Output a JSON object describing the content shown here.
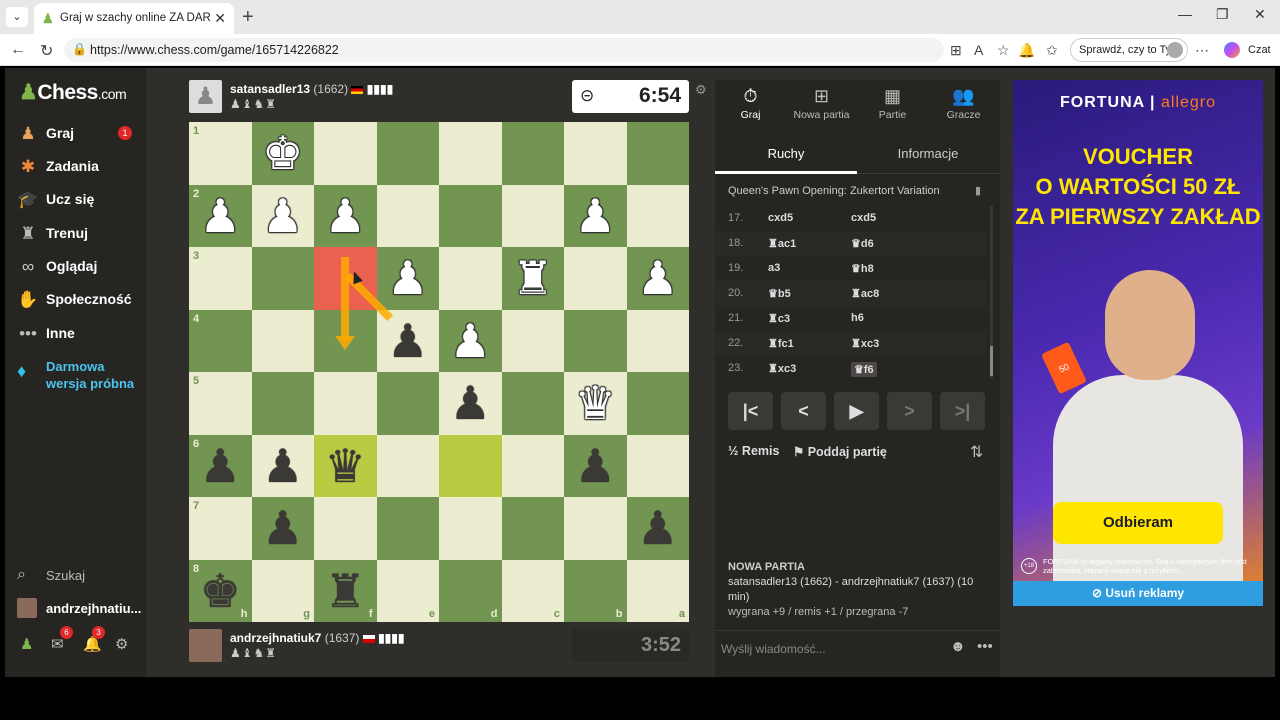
{
  "browser": {
    "tab_title": "Graj w szachy online ZA DARMO",
    "url": "https://www.chess.com/game/165714226822",
    "profile_label": "Sprawdź, czy to Ty",
    "chat_label": "Czat"
  },
  "sidebar": {
    "logo_main": "Chess",
    "logo_suffix": ".com",
    "items": [
      {
        "label": "Graj",
        "icon": "pawn-icon",
        "badge": "1"
      },
      {
        "label": "Zadania",
        "icon": "puzzle-icon"
      },
      {
        "label": "Ucz się",
        "icon": "graduation-cap-icon"
      },
      {
        "label": "Trenuj",
        "icon": "rook-icon"
      },
      {
        "label": "Oglądaj",
        "icon": "binoculars-icon"
      },
      {
        "label": "Społeczność",
        "icon": "community-icon"
      },
      {
        "label": "Inne",
        "icon": "more-dots-icon"
      }
    ],
    "promo": "Darmowa wersja próbna",
    "search": "Szukaj",
    "username": "andrzejhnatiu...",
    "messages_badge": "6",
    "notifications_badge": "3"
  },
  "top_player": {
    "name": "satansadler13",
    "rating": "(1662)",
    "captured": "♟♝♞♜",
    "clock": "6:54"
  },
  "bottom_player": {
    "name": "andrzejhnatiuk7",
    "rating": "(1637)",
    "captured": "♟♝♞♜",
    "clock": "3:52"
  },
  "board": {
    "rank_labels": [
      "1",
      "2",
      "3",
      "4",
      "5",
      "6",
      "7",
      "8"
    ],
    "file_labels": [
      "h",
      "g",
      "f",
      "e",
      "d",
      "c",
      "b",
      "a"
    ],
    "pieces": [
      {
        "r": 0,
        "c": 1,
        "p": "♚",
        "col": "w"
      },
      {
        "r": 1,
        "c": 0,
        "p": "♟",
        "col": "w"
      },
      {
        "r": 1,
        "c": 1,
        "p": "♟",
        "col": "w"
      },
      {
        "r": 1,
        "c": 2,
        "p": "♟",
        "col": "w"
      },
      {
        "r": 1,
        "c": 6,
        "p": "♟",
        "col": "w"
      },
      {
        "r": 2,
        "c": 3,
        "p": "♟",
        "col": "w"
      },
      {
        "r": 2,
        "c": 5,
        "p": "♜",
        "col": "w"
      },
      {
        "r": 2,
        "c": 7,
        "p": "♟",
        "col": "w"
      },
      {
        "r": 3,
        "c": 3,
        "p": "♟",
        "col": "b"
      },
      {
        "r": 3,
        "c": 4,
        "p": "♟",
        "col": "w"
      },
      {
        "r": 4,
        "c": 4,
        "p": "♟",
        "col": "b"
      },
      {
        "r": 4,
        "c": 6,
        "p": "♛",
        "col": "w"
      },
      {
        "r": 5,
        "c": 0,
        "p": "♟",
        "col": "b"
      },
      {
        "r": 5,
        "c": 1,
        "p": "♟",
        "col": "b"
      },
      {
        "r": 5,
        "c": 2,
        "p": "♛",
        "col": "b"
      },
      {
        "r": 5,
        "c": 6,
        "p": "♟",
        "col": "b"
      },
      {
        "r": 6,
        "c": 1,
        "p": "♟",
        "col": "b"
      },
      {
        "r": 6,
        "c": 7,
        "p": "♟",
        "col": "b"
      },
      {
        "r": 7,
        "c": 0,
        "p": "♚",
        "col": "b"
      },
      {
        "r": 7,
        "c": 2,
        "p": "♜",
        "col": "b"
      }
    ],
    "highlights": [
      {
        "r": 2,
        "c": 2,
        "color": "#eb6150"
      },
      {
        "r": 5,
        "c": 2,
        "color": "#b9ca43"
      },
      {
        "r": 5,
        "c": 4,
        "color": "#b9ca43"
      }
    ],
    "arrow_color": "#ffaa00"
  },
  "panel": {
    "tabs": [
      {
        "label": "Graj",
        "icon": "stopwatch-icon"
      },
      {
        "label": "Nowa partia",
        "icon": "plus-square-icon"
      },
      {
        "label": "Partie",
        "icon": "board-icon"
      },
      {
        "label": "Gracze",
        "icon": "players-icon"
      }
    ],
    "subtabs": [
      "Ruchy",
      "Informacje"
    ],
    "opening": "Queen's Pawn Opening: Zukertort Variation",
    "moves": [
      {
        "n": "17.",
        "w": "cxd5",
        "b": "cxd5"
      },
      {
        "n": "18.",
        "w": "♜ac1",
        "b": "♛d6"
      },
      {
        "n": "19.",
        "w": "a3",
        "b": "♛h8"
      },
      {
        "n": "20.",
        "w": "♛b5",
        "b": "♜ac8"
      },
      {
        "n": "21.",
        "w": "♜c3",
        "b": "h6"
      },
      {
        "n": "22.",
        "w": "♜fc1",
        "b": "♜xc3"
      },
      {
        "n": "23.",
        "w": "♜xc3",
        "b": "♛f6"
      }
    ],
    "draw_label": "Remis",
    "resign_label": "Poddaj partię",
    "new_game_heading": "NOWA PARTIA",
    "new_game_players": "satansadler13 (1662) - andrzejhnatiuk7 (1637) (10 min)",
    "new_game_stakes": "wygrana +9 / remis +1 / przegrana -7",
    "chat_placeholder": "Wyślij wiadomość..."
  },
  "ad": {
    "brand_left": "FORTUNA",
    "brand_right": "allegro",
    "headline_1": "VOUCHER",
    "headline_2": "O WARTOŚCI 50 ZŁ",
    "headline_3": "ZA PIERWSZY ZAKŁAD",
    "card_text": "50",
    "cta": "Odbieram",
    "age": "+18",
    "legal": "FORTUNA to legalny bukmacher. Gra u nielegalnych firm jest zabroniona. Hazard wiąże się z ryzykiem.",
    "remove_ads": "Usuń reklamy"
  }
}
